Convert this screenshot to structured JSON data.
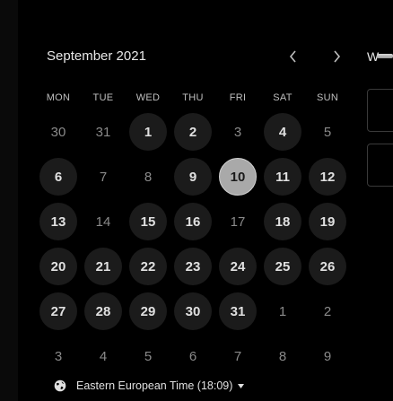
{
  "calendar": {
    "month_title": "September 2021",
    "weekdays": [
      "MON",
      "TUE",
      "WED",
      "THU",
      "FRI",
      "SAT",
      "SUN"
    ],
    "weeks": [
      [
        {
          "d": "30",
          "s": "other"
        },
        {
          "d": "31",
          "s": "other"
        },
        {
          "d": "1",
          "s": "avail"
        },
        {
          "d": "2",
          "s": "avail"
        },
        {
          "d": "3",
          "s": "plain"
        },
        {
          "d": "4",
          "s": "avail"
        },
        {
          "d": "5",
          "s": "plain"
        }
      ],
      [
        {
          "d": "6",
          "s": "avail"
        },
        {
          "d": "7",
          "s": "plain"
        },
        {
          "d": "8",
          "s": "plain"
        },
        {
          "d": "9",
          "s": "avail"
        },
        {
          "d": "10",
          "s": "selected"
        },
        {
          "d": "11",
          "s": "avail"
        },
        {
          "d": "12",
          "s": "avail"
        }
      ],
      [
        {
          "d": "13",
          "s": "avail"
        },
        {
          "d": "14",
          "s": "plain"
        },
        {
          "d": "15",
          "s": "avail"
        },
        {
          "d": "16",
          "s": "avail"
        },
        {
          "d": "17",
          "s": "plain"
        },
        {
          "d": "18",
          "s": "avail"
        },
        {
          "d": "19",
          "s": "avail"
        }
      ],
      [
        {
          "d": "20",
          "s": "avail"
        },
        {
          "d": "21",
          "s": "avail"
        },
        {
          "d": "22",
          "s": "avail"
        },
        {
          "d": "23",
          "s": "avail"
        },
        {
          "d": "24",
          "s": "avail"
        },
        {
          "d": "25",
          "s": "avail"
        },
        {
          "d": "26",
          "s": "avail"
        }
      ],
      [
        {
          "d": "27",
          "s": "avail"
        },
        {
          "d": "28",
          "s": "avail"
        },
        {
          "d": "29",
          "s": "avail"
        },
        {
          "d": "30",
          "s": "avail"
        },
        {
          "d": "31",
          "s": "avail"
        },
        {
          "d": "1",
          "s": "other"
        },
        {
          "d": "2",
          "s": "other"
        }
      ],
      [
        {
          "d": "3",
          "s": "other"
        },
        {
          "d": "4",
          "s": "other"
        },
        {
          "d": "5",
          "s": "other"
        },
        {
          "d": "6",
          "s": "other"
        },
        {
          "d": "7",
          "s": "other"
        },
        {
          "d": "8",
          "s": "other"
        },
        {
          "d": "9",
          "s": "other"
        }
      ]
    ],
    "selected_day": "10"
  },
  "timezone": {
    "label": "Eastern European Time (18:09)",
    "icon": "globe-icon"
  },
  "right_panel": {
    "header_partial": "W"
  },
  "colors": {
    "background": "#000000",
    "available_day_bg": "#1b1b1b",
    "selected_day_bg": "#a9a9a9"
  }
}
